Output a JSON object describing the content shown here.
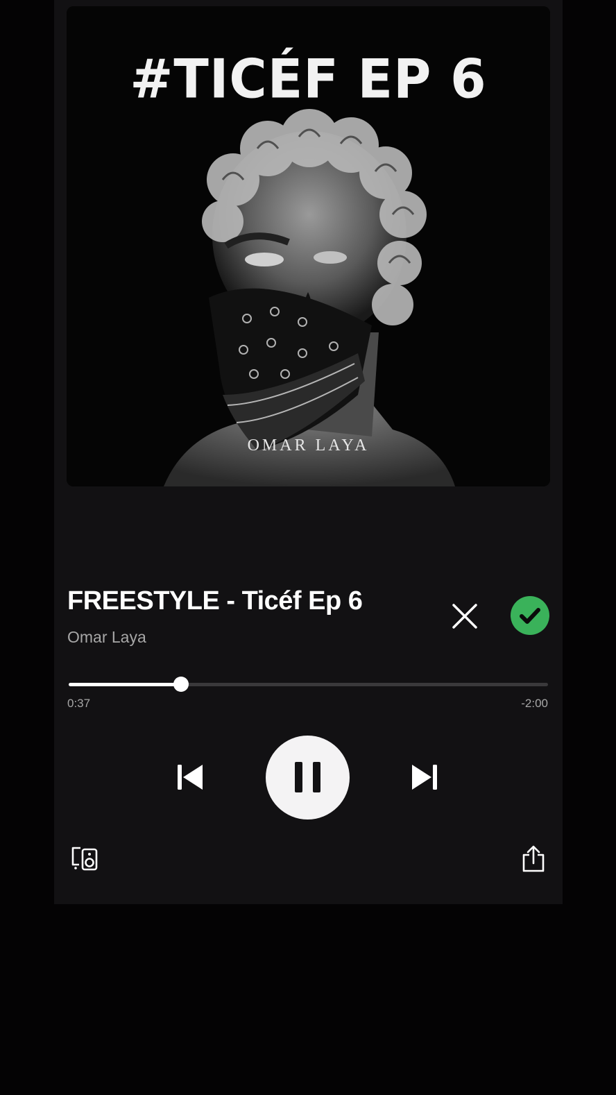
{
  "artwork": {
    "title_text": "#TICÉF EP 6",
    "artist_text": "OMAR LAYA"
  },
  "track": {
    "title": "FREESTYLE - Ticéf Ep 6",
    "artist": "Omar Laya"
  },
  "playback": {
    "elapsed": "0:37",
    "remaining": "-2:00",
    "progress_fraction": 0.235,
    "state": "playing"
  },
  "icons": {
    "dismiss": "close-icon",
    "saved": "check-icon",
    "previous": "skip-previous-icon",
    "pause": "pause-icon",
    "next": "skip-next-icon",
    "devices": "connect-device-icon",
    "share": "share-icon"
  },
  "colors": {
    "background": "#121113",
    "saved_accent": "#3ab25a",
    "progress_fill": "#ffffff",
    "progress_track": "#3a393b",
    "secondary_text": "#a7a7a7"
  }
}
